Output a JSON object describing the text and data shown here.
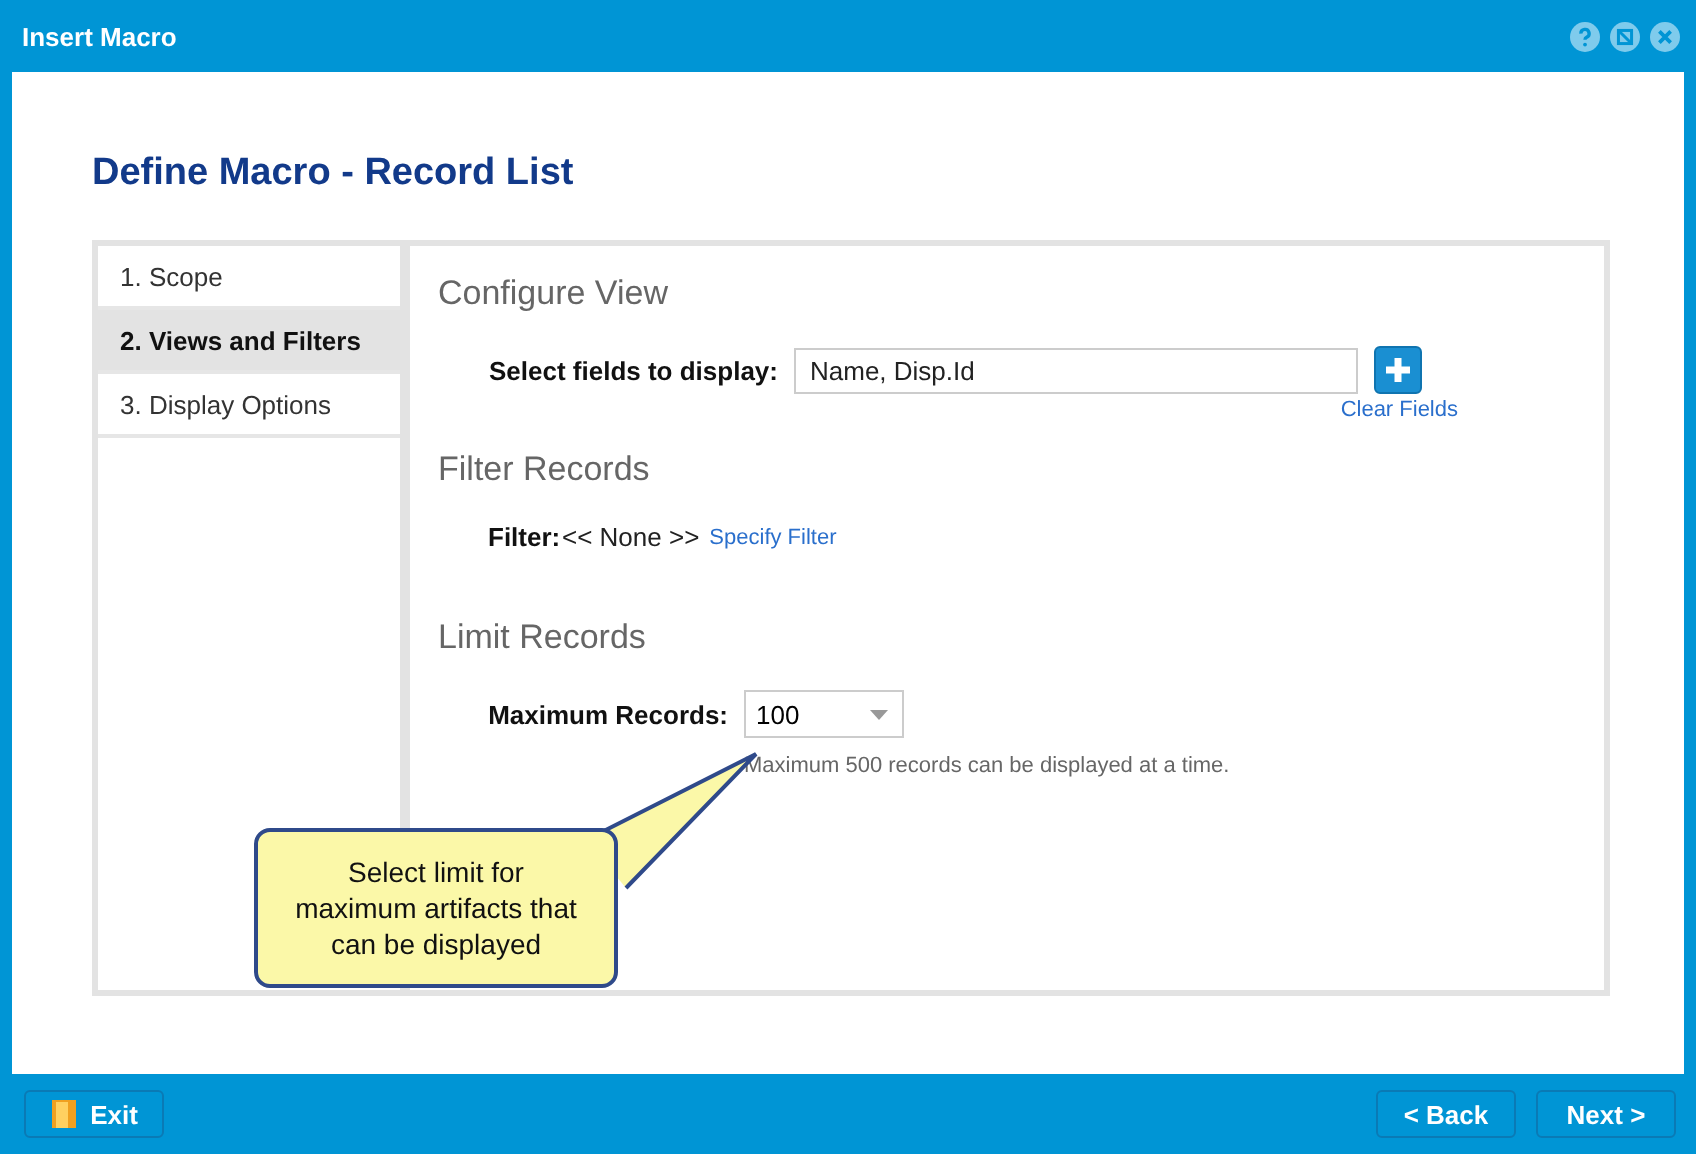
{
  "window": {
    "title": "Insert Macro"
  },
  "heading": "Define Macro - Record List",
  "steps": [
    {
      "label": "1. Scope",
      "selected": false
    },
    {
      "label": "2. Views and Filters",
      "selected": true
    },
    {
      "label": "3. Display Options",
      "selected": false
    }
  ],
  "configure": {
    "title": "Configure View",
    "label": "Select fields to display:",
    "value": "Name, Disp.Id",
    "clear": "Clear Fields"
  },
  "filter": {
    "title": "Filter Records",
    "label": "Filter:",
    "value": "<< None >>",
    "link": "Specify Filter"
  },
  "limit": {
    "title": "Limit Records",
    "label": "Maximum Records:",
    "value": "100",
    "hint": "Maximum 500 records can be displayed at a time."
  },
  "callout": "Select limit for maximum artifacts that can be displayed",
  "footer": {
    "exit": "Exit",
    "back": "< Back",
    "next": "Next >"
  }
}
